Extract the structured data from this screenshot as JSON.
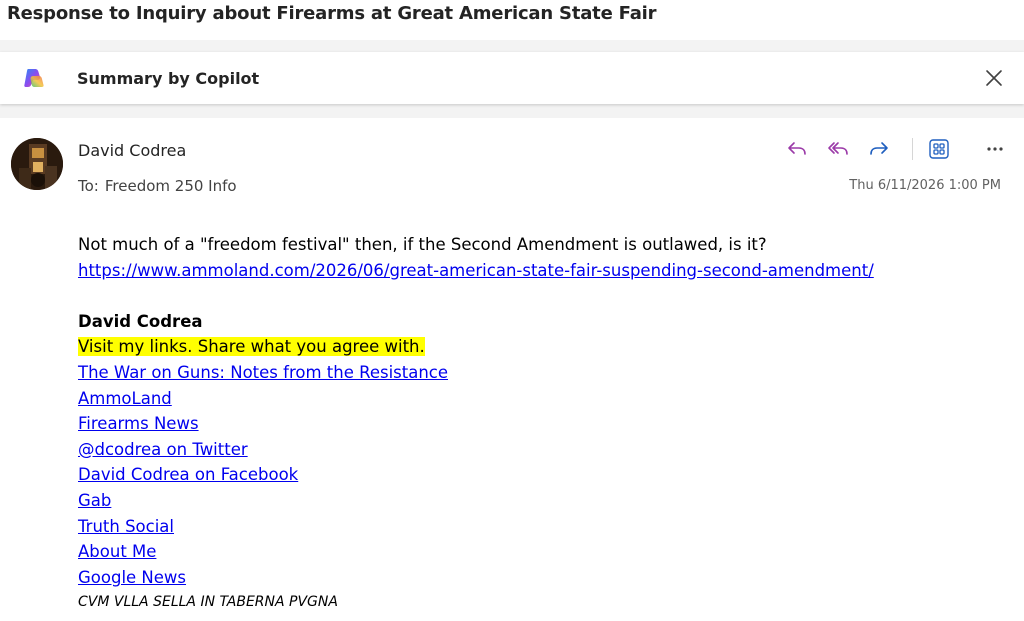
{
  "message": {
    "subject": "Response to Inquiry about Firearms at Great American State Fair",
    "sender": "David Codrea",
    "to_label": "To:",
    "to_value": "Freedom 250 Info",
    "timestamp": "Thu 6/11/2026 1:00 PM"
  },
  "copilot": {
    "title": "Summary by Copilot",
    "logo_icon": "copilot-logo-icon",
    "close_icon": "close-icon"
  },
  "toolbar": {
    "icons": [
      "reply-icon",
      "reply-all-icon",
      "forward-icon",
      "apps-icon",
      "more-icon"
    ],
    "accent": "#9b3aa8",
    "forward_color": "#1f5fbf"
  },
  "body": {
    "question": "Not much of a \"freedom festival\" then, if the Second Amendment is outlawed, is it?",
    "article_link": "https://www.ammoland.com/2026/06/great-american-state-fair-suspending-second-amendment/",
    "signature": {
      "name": "David Codrea",
      "tagline": "Visit my links. Share what you agree with.",
      "links": [
        "The War on Guns: Notes from the Resistance",
        "AmmoLand",
        "Firearms News",
        "@dcodrea on Twitter",
        "David Codrea on Facebook",
        "Gab",
        "Truth Social",
        "About Me",
        "Google News"
      ],
      "motto": "CVM VLLA SELLA IN TABERNA PVGNA"
    }
  },
  "colors": {
    "link": "#0000ee",
    "highlight": "#ffff00",
    "band": "#f3f3f3"
  }
}
